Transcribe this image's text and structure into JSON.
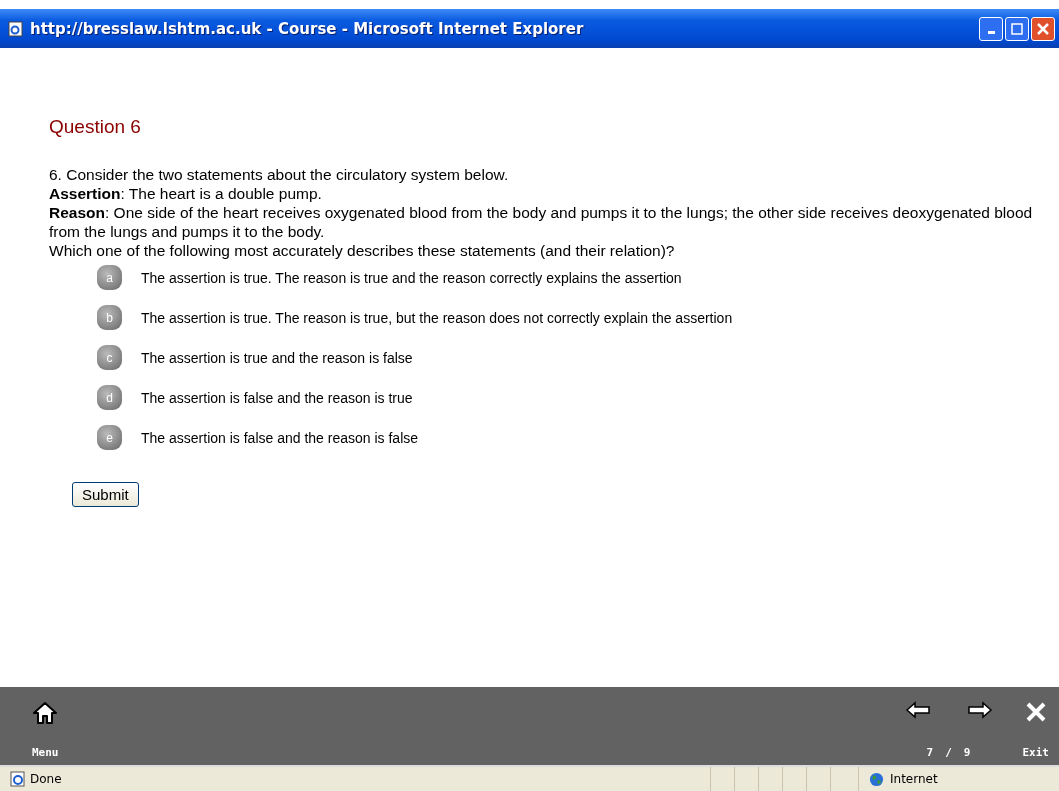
{
  "window": {
    "title": "http://bresslaw.lshtm.ac.uk - Course - Microsoft Internet Explorer"
  },
  "question": {
    "heading": "Question 6",
    "lines": [
      "6. Consider the two statements about the circulatory system below.",
      "**Assertion**: The heart is a double pump.",
      "**Reason**: One side of the heart receives oxygenated blood from the body and pumps it to the lungs; the other side receives deoxygenated blood from the lungs and pumps it to the body.",
      "Which one of the following most accurately describes these statements (and their relation)?"
    ],
    "options": [
      {
        "letter": "a",
        "text": "The assertion is true. The reason is true and the reason correctly explains the assertion"
      },
      {
        "letter": "b",
        "text": "The assertion is true. The reason is true, but the reason does not correctly explain the assertion"
      },
      {
        "letter": "c",
        "text": "The assertion is true and the reason is false"
      },
      {
        "letter": "d",
        "text": "The assertion is false and the reason is true"
      },
      {
        "letter": "e",
        "text": "The assertion is false and the reason is false"
      }
    ],
    "submit": "Submit"
  },
  "nav": {
    "menu": "Menu",
    "page": "7",
    "separator": "/",
    "total": "9",
    "exit": "Exit"
  },
  "status_bar": {
    "text": "Done",
    "zone": "Internet"
  }
}
